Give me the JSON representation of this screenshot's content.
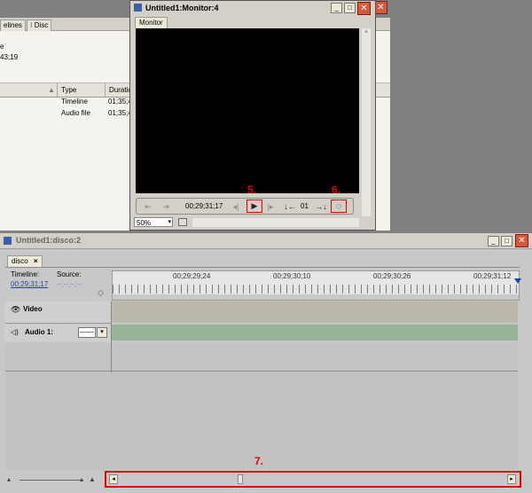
{
  "project_panel": {
    "tabs": [
      "elines",
      "Disc"
    ],
    "info_lines": [
      "e",
      "43;19"
    ],
    "columns": [
      "Type",
      "Duratio"
    ],
    "rows": [
      {
        "type": "Timeline",
        "duration": "01;35;4"
      },
      {
        "type": "Audio file",
        "duration": "01;35;4"
      }
    ]
  },
  "monitor": {
    "title": "Untitled1:Monitor:4",
    "tab": "Monitor",
    "timecode": "00;29;31;17",
    "in_out_count": "01",
    "zoom": "50%"
  },
  "timeline": {
    "title": "Untitled1:disco:2",
    "tab": "disco",
    "timeline_label": "Timeline:",
    "timeline_time": "00;29;31;17",
    "source_label": "Source:",
    "source_time": "--;--;--;--",
    "ruler_ticks": [
      "00;29;29;24",
      "00;29;30;10",
      "00;29;30;26",
      "00;29;31;12"
    ],
    "tracks": {
      "video": "Video",
      "audio": "Audio 1:",
      "audio_mode": "——"
    }
  },
  "callouts": {
    "c5": "5.",
    "c6": "6.",
    "c7": "7."
  },
  "colors": {
    "desktop": "#808080",
    "window": "#d4d0c8",
    "screen": "#000000",
    "audio_track": "#97b596",
    "video_track": "#bdb8ac",
    "callout": "#e00000"
  }
}
